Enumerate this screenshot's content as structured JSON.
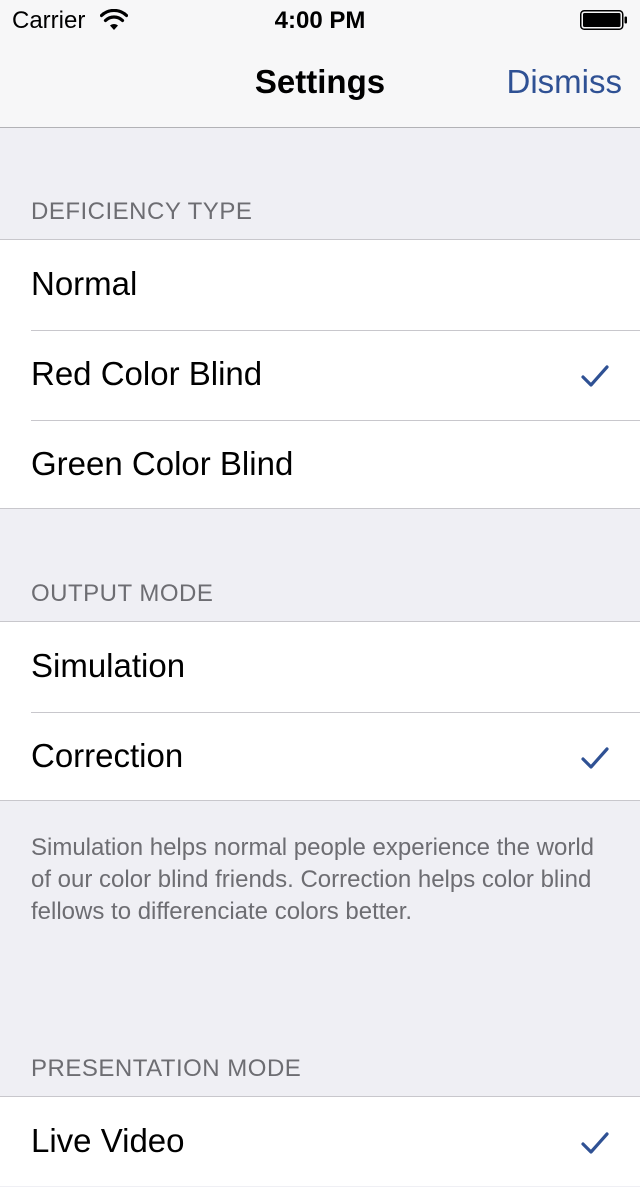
{
  "status_bar": {
    "carrier": "Carrier",
    "time": "4:00 PM",
    "icons": [
      "wifi-icon",
      "battery-icon"
    ]
  },
  "nav": {
    "title": "Settings",
    "dismiss_label": "Dismiss"
  },
  "colors": {
    "accent": "#2f5194",
    "background": "#efeff4",
    "section_header_text": "#6d6d72",
    "separator": "#c8c7cc"
  },
  "sections": [
    {
      "header": "DEFICIENCY TYPE",
      "rows": [
        {
          "label": "Normal",
          "selected": false
        },
        {
          "label": "Red Color Blind",
          "selected": true
        },
        {
          "label": "Green Color Blind",
          "selected": false
        }
      ]
    },
    {
      "header": "OUTPUT MODE",
      "rows": [
        {
          "label": "Simulation",
          "selected": false
        },
        {
          "label": "Correction",
          "selected": true
        }
      ],
      "footer": "Simulation helps normal people experience the world of our color blind friends. Correction helps color blind fellows to differenciate colors better."
    },
    {
      "header": "PRESENTATION MODE",
      "rows": [
        {
          "label": "Live Video",
          "selected": true
        }
      ]
    }
  ]
}
